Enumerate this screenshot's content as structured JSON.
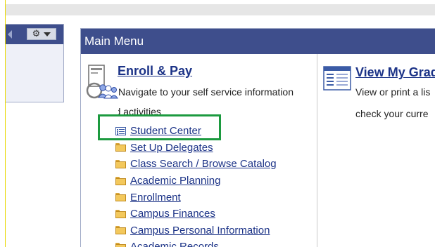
{
  "left_panel": {
    "icons": [
      "collapse-arrow-icon",
      "gear-icon",
      "chevron-down-icon"
    ],
    "gear_glyph": "⚙"
  },
  "main_menu": {
    "title": "Main Menu",
    "enroll": {
      "title": "Enroll & Pay",
      "icon": "enroll-people-icon",
      "description_lines": [
        "Navigate to your self service information",
        "and activities"
      ],
      "items": [
        {
          "label": "Student Center",
          "icon": "list-page-icon"
        },
        {
          "label": "Set Up Delegates",
          "icon": "folder-icon"
        },
        {
          "label": "Class Search / Browse Catalog",
          "icon": "folder-icon"
        },
        {
          "label": "Academic Planning",
          "icon": "folder-icon"
        },
        {
          "label": "Enrollment",
          "icon": "folder-icon"
        },
        {
          "label": "Campus Finances",
          "icon": "folder-icon"
        },
        {
          "label": "Campus Personal Information",
          "icon": "folder-icon"
        },
        {
          "label": "Academic Records",
          "icon": "folder-icon"
        }
      ]
    },
    "grades": {
      "title": "View My Grade",
      "icon": "grades-window-icon",
      "description_lines": [
        "View or print a lis",
        "check your curre"
      ]
    }
  },
  "highlight": {
    "target": "Student Center",
    "color": "#1c9a3f"
  },
  "colors": {
    "header": "#3e4e8c",
    "link": "#1c3387",
    "highlight": "#1c9a3f"
  }
}
